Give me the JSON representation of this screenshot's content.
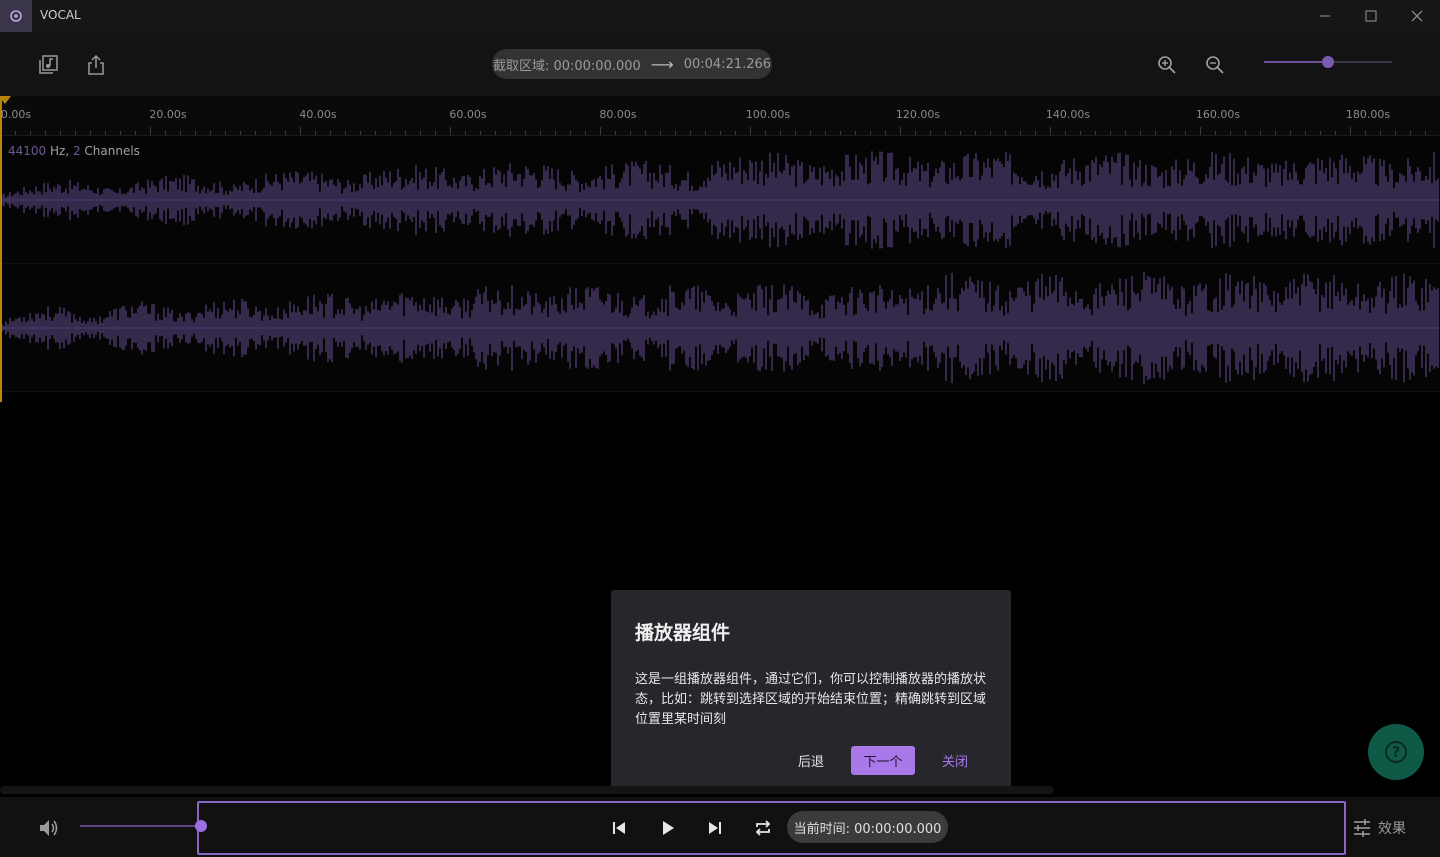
{
  "app": {
    "title": "VOCAL"
  },
  "toolbar": {
    "region_label": "截取区域: 00:00:00.000",
    "region_end": "00:04:21.266",
    "zoom_level": 0.5
  },
  "ruler": {
    "labels": [
      "0.00s",
      "20.00s",
      "40.00s",
      "60.00s",
      "80.00s",
      "100.00s",
      "120.00s",
      "140.00s",
      "160.00s",
      "180.00s"
    ]
  },
  "waveform": {
    "sample_rate": "44100",
    "hz_text": " Hz, ",
    "channels": "2",
    "channels_text": " Channels",
    "color": "#4b3a6b"
  },
  "dialog": {
    "title": "播放器组件",
    "body": "这是一组播放器组件，通过它们，你可以控制播放器的播放状态，比如：跳转到选择区域的开始结束位置；精确跳转到区域位置里某时间刻",
    "back_label": "后退",
    "next_label": "下一个",
    "close_label": "关闭"
  },
  "help": {
    "glyph": "?"
  },
  "player": {
    "current_time": "当前时间: 00:00:00.000",
    "effect_label": "效果",
    "volume_level": 1.0
  },
  "colors": {
    "accent": "#a978e9",
    "waveform": "#4b3a6b",
    "playhead": "#b8860b",
    "help_fab": "#0f5a47"
  }
}
